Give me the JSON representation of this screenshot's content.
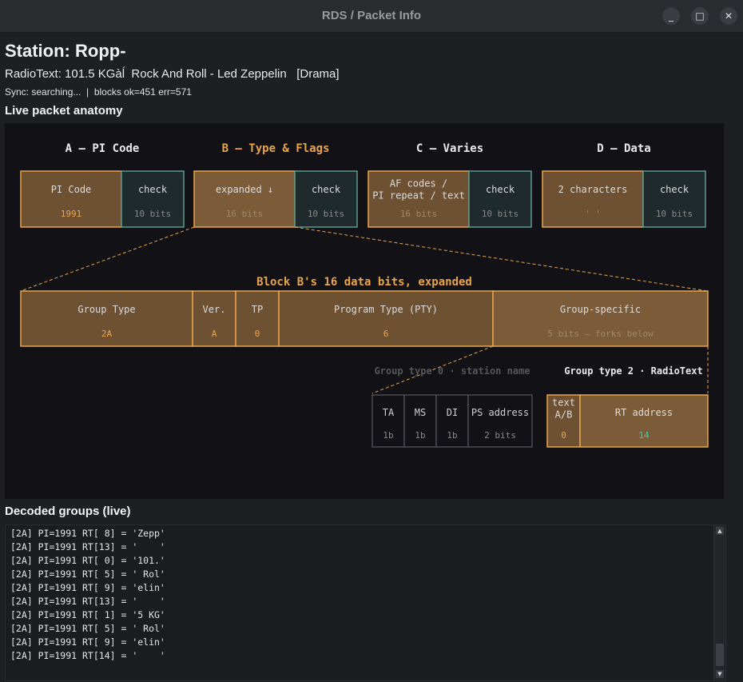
{
  "window": {
    "title": "RDS / Packet Info",
    "minimize_glyph": "_",
    "maximize_glyph": "□",
    "close_glyph": "✕"
  },
  "station": "Station: Ropp-",
  "radiotext": "RadioText: 101.5 KGàĺ  Rock And Roll - Led Zeppelin   [Drama]",
  "status": "Sync: searching...  |  blocks ok=451 err=571",
  "anatomy_title": "Live packet anatomy",
  "blocks": [
    {
      "header": "A — PI Code",
      "data_label": "PI Code",
      "data_value": "1991",
      "check_label": "check",
      "check_bits": "10 bits",
      "highlight": false
    },
    {
      "header": "B — Type & Flags",
      "data_label": "expanded ↓",
      "data_value": "16 bits",
      "check_label": "check",
      "check_bits": "10 bits",
      "highlight": true
    },
    {
      "header": "C — Varies",
      "data_label": "AF codes /\nPI repeat / text",
      "data_value": "16 bits",
      "check_label": "check",
      "check_bits": "10 bits",
      "highlight": false
    },
    {
      "header": "D — Data",
      "data_label": "2 characters",
      "data_value": "'    '",
      "check_label": "check",
      "check_bits": "10 bits",
      "highlight": false
    }
  ],
  "expanded_title": "Block B's 16 data bits, expanded",
  "bitfields": [
    {
      "label": "Group Type",
      "value": "2A"
    },
    {
      "label": "Ver.",
      "value": "A"
    },
    {
      "label": "TP",
      "value": "0"
    },
    {
      "label": "Program Type (PTY)",
      "value": "6"
    },
    {
      "label": "Group-specific",
      "value": "5 bits — forks below"
    }
  ],
  "group0": {
    "title": "Group type 0 · station name",
    "fields": [
      {
        "label": "TA",
        "value": "1b"
      },
      {
        "label": "MS",
        "value": "1b"
      },
      {
        "label": "DI",
        "value": "1b"
      },
      {
        "label": "PS address",
        "value": "2 bits"
      }
    ]
  },
  "group2": {
    "title": "Group type 2 · RadioText",
    "fields": [
      {
        "label": "text\nA/B",
        "value": "0"
      },
      {
        "label": "RT address",
        "value": "14"
      }
    ]
  },
  "decoded_title": "Decoded groups (live)",
  "log": [
    "[2A] PI=1991 RT[ 8] = 'Zepp'",
    "[2A] PI=1991 RT[13] = '    '",
    "[2A] PI=1991 RT[ 0] = '101.'",
    "[2A] PI=1991 RT[ 5] = ' Rol'",
    "[2A] PI=1991 RT[ 9] = 'elin'",
    "[2A] PI=1991 RT[13] = '    '",
    "[2A] PI=1991 RT[ 1] = '5 KG'",
    "[2A] PI=1991 RT[ 5] = ' Rol'",
    "[2A] PI=1991 RT[ 9] = 'elin'",
    "[2A] PI=1991 RT[14] = '    '"
  ],
  "colors": {
    "orange": "#e8a54c",
    "brown_fill": "#6e5132",
    "brown_fill_light": "#7c5c38",
    "teal_border": "#5a9a8e",
    "teal_fill": "#1f2a2c",
    "teal_value": "#58c0a0"
  }
}
